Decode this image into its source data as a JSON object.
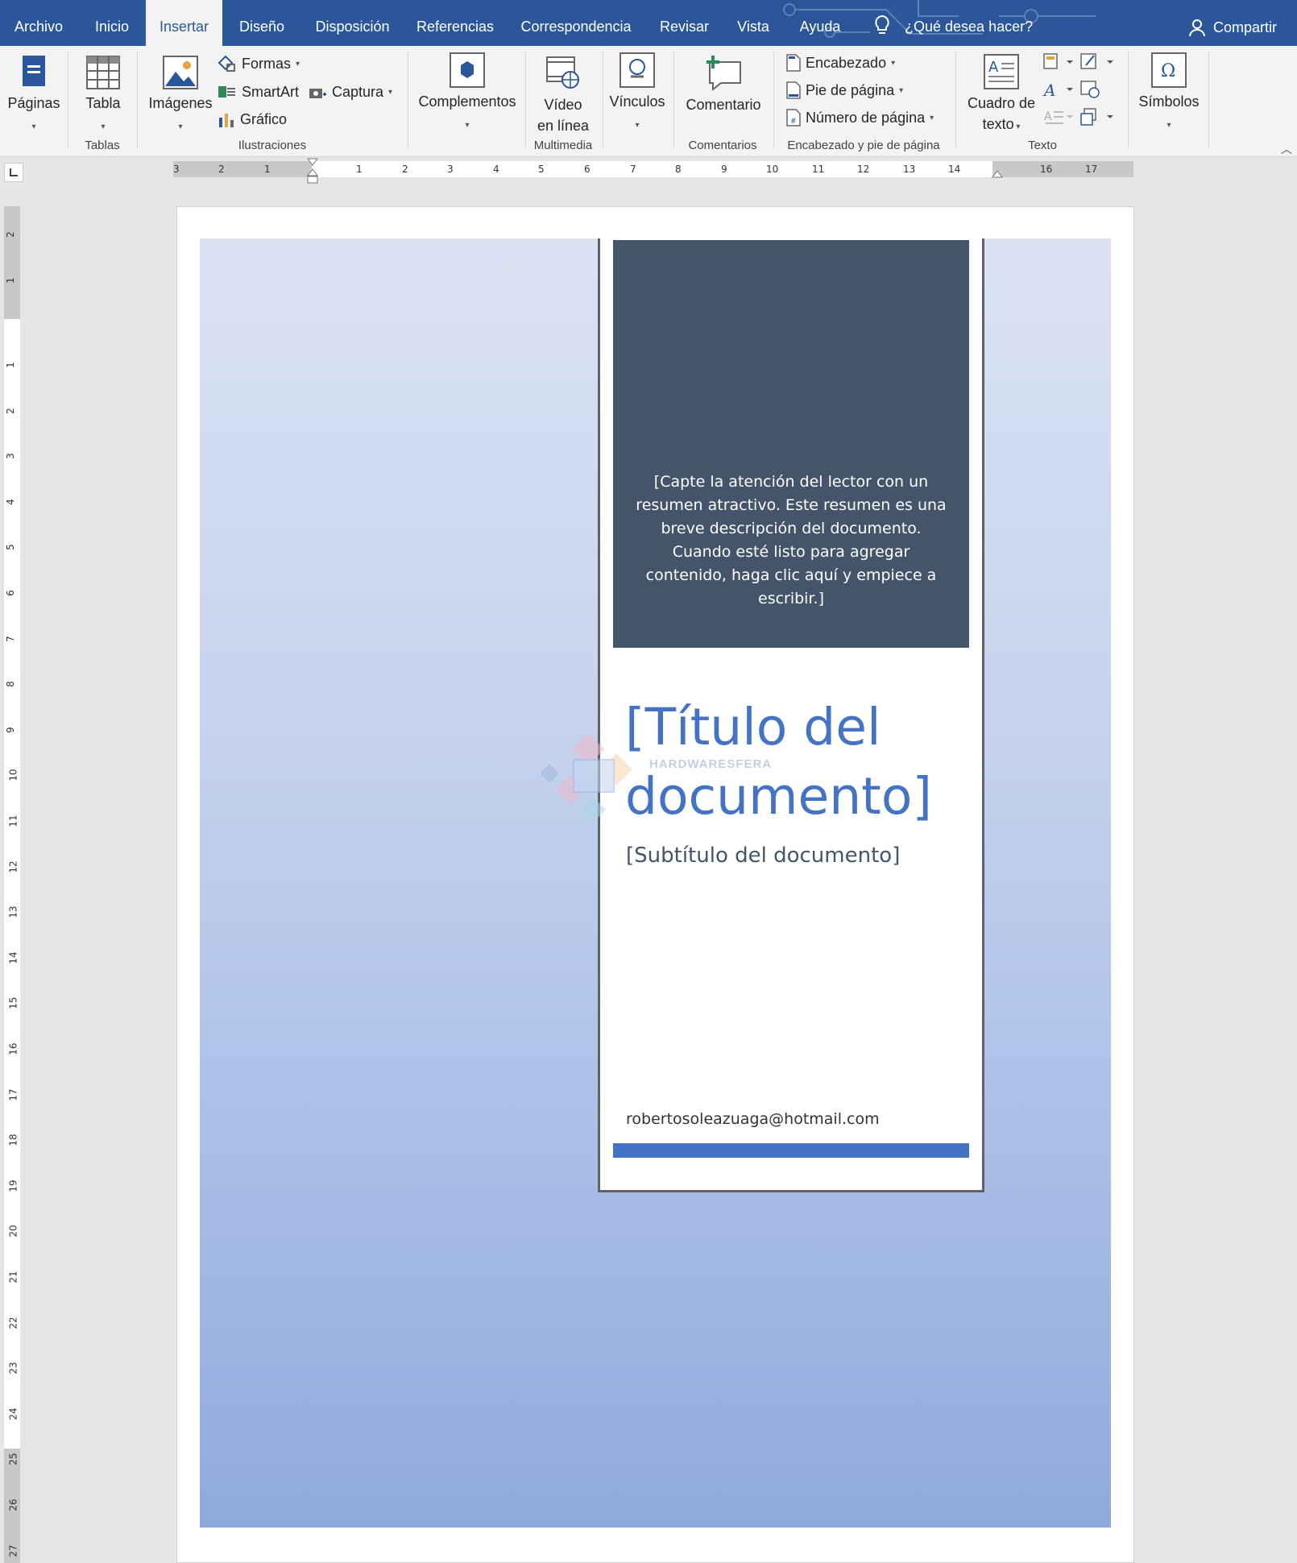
{
  "menubar": {
    "tabs": [
      "Archivo",
      "Inicio",
      "Insertar",
      "Diseño",
      "Disposición",
      "Referencias",
      "Correspondencia",
      "Revisar",
      "Vista",
      "Ayuda"
    ],
    "active_tab": "Insertar",
    "search_text": "¿Qué desea hacer?",
    "share_label": "Compartir",
    "bg_color": "#2b579a"
  },
  "ribbon": {
    "paginas": "Páginas",
    "tabla": "Tabla",
    "imagenes": "Imágenes",
    "formas": "Formas",
    "smartart": "SmartArt",
    "grafico": "Gráfico",
    "captura": "Captura",
    "complementos": "Complementos",
    "video_line1": "Vídeo",
    "video_line2": "en línea",
    "vinculos": "Vínculos",
    "comentario": "Comentario",
    "encabezado": "Encabezado",
    "pie_pagina": "Pie de página",
    "numero_pagina": "Número de página",
    "cuadro_line1": "Cuadro de",
    "cuadro_line2": "texto",
    "simbolos": "Símbolos",
    "groups": {
      "tablas": "Tablas",
      "ilustraciones": "Ilustraciones",
      "multimedia": "Multimedia",
      "comentarios": "Comentarios",
      "encabezado_pie": "Encabezado y pie de página",
      "texto": "Texto"
    }
  },
  "ruler": {
    "horizontal_labels": [
      "3",
      "2",
      "1",
      "1",
      "2",
      "3",
      "4",
      "5",
      "6",
      "7",
      "8",
      "9",
      "10",
      "11",
      "12",
      "13",
      "14",
      "16",
      "17"
    ],
    "vertical_labels": [
      "2",
      "1",
      "1",
      "2",
      "3",
      "4",
      "5",
      "6",
      "7",
      "8",
      "9",
      "10",
      "11",
      "12",
      "13",
      "14",
      "15",
      "16",
      "17",
      "18",
      "19",
      "20",
      "21",
      "22",
      "23",
      "24",
      "25",
      "26",
      "27"
    ]
  },
  "document": {
    "abstract": "[Capte la atención del lector con un resumen atractivo. Este resumen es una breve descripción del documento. Cuando esté listo para agregar contenido, haga clic aquí y empiece a escribir.]",
    "title": "[Título del documento]",
    "subtitle": "[Subtítulo del documento]",
    "email": "robertosoleazuaga@hotmail.com",
    "watermark_text": "HARDWARESFERA",
    "colors": {
      "abstract_bg": "#44546a",
      "title": "#4472c4",
      "accent_bar": "#4472c4"
    }
  }
}
